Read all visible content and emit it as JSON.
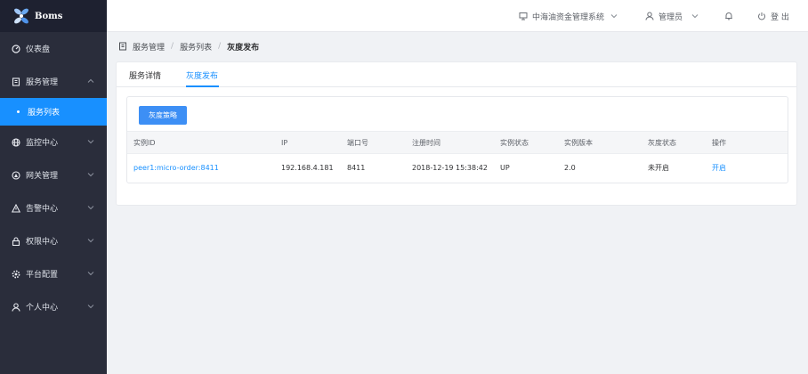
{
  "app": {
    "name": "Boms"
  },
  "sidebar": {
    "items": [
      {
        "label": "仪表盘",
        "icon": "dashboard-icon"
      },
      {
        "label": "服务管理",
        "icon": "service-icon",
        "expanded": true
      },
      {
        "label": "服务列表",
        "active": true
      },
      {
        "label": "监控中心",
        "icon": "monitor-icon"
      },
      {
        "label": "网关管理",
        "icon": "gateway-icon"
      },
      {
        "label": "告警中心",
        "icon": "alert-icon"
      },
      {
        "label": "权限中心",
        "icon": "lock-icon"
      },
      {
        "label": "平台配置",
        "icon": "settings-icon"
      },
      {
        "label": "个人中心",
        "icon": "user-icon"
      }
    ]
  },
  "header": {
    "system": "中海油资金管理系统",
    "user": "管理员",
    "logout": "登 出"
  },
  "breadcrumb": [
    "服务管理",
    "服务列表",
    "灰度发布"
  ],
  "tabs": [
    {
      "label": "服务详情",
      "active": false
    },
    {
      "label": "灰度发布",
      "active": true
    }
  ],
  "strategy_button": "灰度策略",
  "table": {
    "columns": [
      "实例ID",
      "IP",
      "端口号",
      "注册时间",
      "实例状态",
      "实例版本",
      "灰度状态",
      "操作"
    ],
    "rows": [
      [
        "peer1:micro-order:8411",
        "192.168.4.181",
        "8411",
        "2018-12-19 15:38:42",
        "UP",
        "2.0",
        "未开启",
        "开启"
      ]
    ]
  },
  "colors": {
    "accent": "#1890ff",
    "sidebar": "#2a2d3b",
    "logo_bg": "#1e2130"
  }
}
